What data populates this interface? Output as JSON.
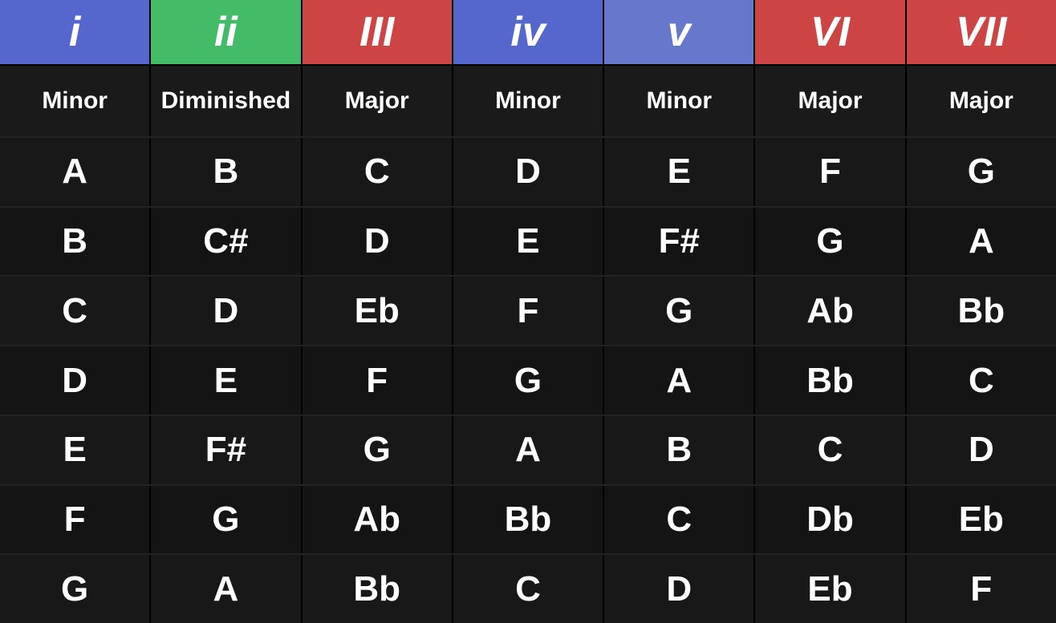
{
  "headers": [
    {
      "label": "i",
      "class": "col-i-header"
    },
    {
      "label": "ii",
      "class": "col-ii-header"
    },
    {
      "label": "III",
      "class": "col-iii-header"
    },
    {
      "label": "iv",
      "class": "col-iv-header"
    },
    {
      "label": "v",
      "class": "col-v-header"
    },
    {
      "label": "VI",
      "class": "col-vi-header"
    },
    {
      "label": "VII",
      "class": "col-vii-header"
    }
  ],
  "qualities": [
    "Minor",
    "Diminished",
    "Major",
    "Minor",
    "Minor",
    "Major",
    "Major"
  ],
  "rows": [
    [
      "A",
      "B",
      "C",
      "D",
      "E",
      "F",
      "G"
    ],
    [
      "B",
      "C#",
      "D",
      "E",
      "F#",
      "G",
      "A"
    ],
    [
      "C",
      "D",
      "Eb",
      "F",
      "G",
      "Ab",
      "Bb"
    ],
    [
      "D",
      "E",
      "F",
      "G",
      "A",
      "Bb",
      "C"
    ],
    [
      "E",
      "F#",
      "G",
      "A",
      "B",
      "C",
      "D"
    ],
    [
      "F",
      "G",
      "Ab",
      "Bb",
      "C",
      "Db",
      "Eb"
    ],
    [
      "G",
      "A",
      "Bb",
      "C",
      "D",
      "Eb",
      "F"
    ]
  ]
}
